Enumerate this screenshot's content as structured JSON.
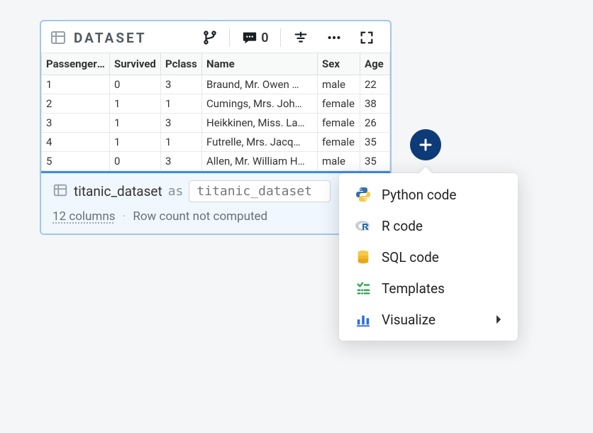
{
  "header": {
    "title": "DATASET",
    "comment_count": "0"
  },
  "table": {
    "columns": [
      "PassengerId",
      "Survived",
      "Pclass",
      "Name",
      "Sex",
      "Age"
    ],
    "rows": [
      {
        "c": [
          "1",
          "0",
          "3",
          "Braund, Mr. Owen …",
          "male",
          "22"
        ]
      },
      {
        "c": [
          "2",
          "1",
          "1",
          "Cumings, Mrs. Joh…",
          "female",
          "38"
        ]
      },
      {
        "c": [
          "3",
          "1",
          "3",
          "Heikkinen, Miss. La…",
          "female",
          "26"
        ]
      },
      {
        "c": [
          "4",
          "1",
          "1",
          "Futrelle, Mrs. Jacq…",
          "female",
          "35"
        ]
      },
      {
        "c": [
          "5",
          "0",
          "3",
          "Allen, Mr. William H…",
          "male",
          "35"
        ]
      }
    ]
  },
  "footer": {
    "dataset_name": "titanic_dataset",
    "as_keyword": "as",
    "alias_value": "titanic_dataset",
    "columns_label": "12 columns",
    "separator": "·",
    "rowcount_label": "Row count not computed"
  },
  "menu": {
    "items": [
      {
        "key": "python",
        "label": "Python code"
      },
      {
        "key": "r",
        "label": "R code"
      },
      {
        "key": "sql",
        "label": "SQL code"
      },
      {
        "key": "templates",
        "label": "Templates"
      },
      {
        "key": "visualize",
        "label": "Visualize",
        "has_submenu": true
      }
    ]
  }
}
